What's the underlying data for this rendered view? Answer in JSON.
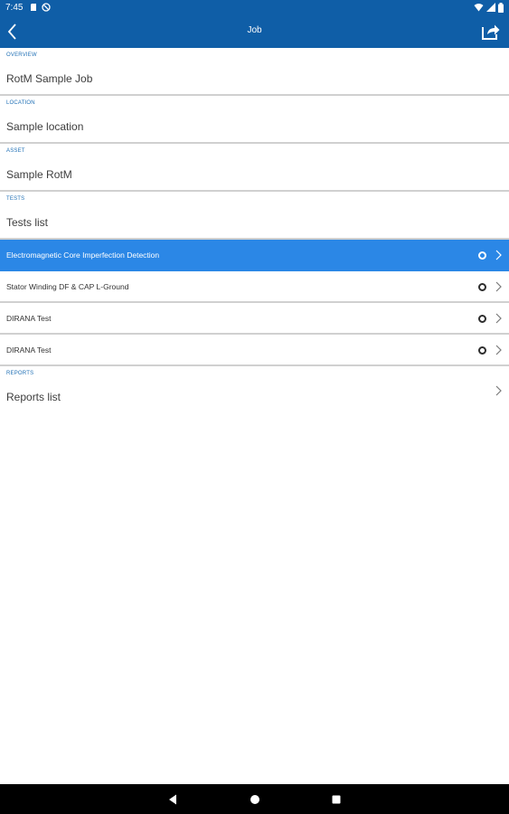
{
  "status_bar": {
    "time": "7:45"
  },
  "app_bar": {
    "title": "Job"
  },
  "sections": {
    "overview": {
      "caption": "OVERVIEW",
      "value": "RotM Sample Job"
    },
    "location": {
      "caption": "LOCATION",
      "value": "Sample location"
    },
    "asset": {
      "caption": "ASSET",
      "value": "Sample RotM"
    },
    "tests": {
      "caption": "TESTS",
      "value": "Tests list"
    },
    "reports": {
      "caption": "REPORTS",
      "value": "Reports list"
    }
  },
  "tests": [
    {
      "label": "Electromagnetic Core Imperfection Detection",
      "selected": true
    },
    {
      "label": "Stator Winding DF & CAP L-Ground",
      "selected": false
    },
    {
      "label": "DIRANA Test",
      "selected": false
    },
    {
      "label": "DIRANA Test",
      "selected": false
    }
  ],
  "colors": {
    "primary": "#0f5ea7",
    "selected_row": "#2b87e6",
    "caption": "#1f6fb5",
    "divider": "#d0d0d0"
  },
  "icons": {
    "back": "chevron-left-icon",
    "share": "share-icon",
    "status": "circle-status-icon",
    "row_chevron": "chevron-right-icon"
  }
}
